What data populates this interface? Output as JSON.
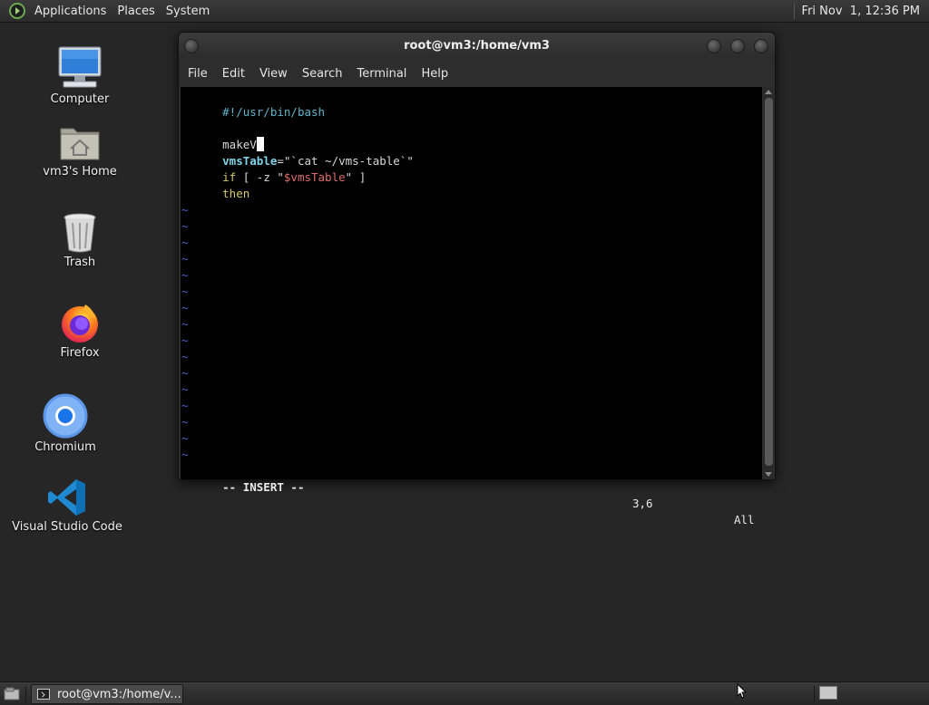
{
  "top_panel": {
    "menus": [
      "Applications",
      "Places",
      "System"
    ],
    "clock": "Fri Nov  1, 12:36 PM"
  },
  "desktop_icons": [
    {
      "label": "Computer",
      "icon": "computer-icon"
    },
    {
      "label": "vm3's Home",
      "icon": "home-folder-icon"
    },
    {
      "label": "Trash",
      "icon": "trash-icon"
    },
    {
      "label": "Firefox",
      "icon": "firefox-icon"
    },
    {
      "label": "Chromium",
      "icon": "chromium-icon"
    },
    {
      "label": "Visual Studio Code",
      "icon": "vscode-icon"
    }
  ],
  "terminal": {
    "title": "root@vm3:/home/vm3",
    "menu": [
      "File",
      "Edit",
      "View",
      "Search",
      "Terminal",
      "Help"
    ],
    "lines": {
      "shebang": "#!/usr/bin/bash",
      "make": "makeV",
      "assign_var": "vmsTable",
      "assign_eq": "=\"`cat ~/vms-table`\"",
      "if_kw": "if",
      "if_mid": " [ -z \"",
      "if_var": "$vmsTable",
      "if_end": "\" ]",
      "then_kw": "then"
    },
    "tilde": "~",
    "empty_line_count": 16,
    "status": {
      "mode": "-- INSERT --",
      "position": "3,6",
      "scroll": "All"
    }
  },
  "taskbar": {
    "task_label": "root@vm3:/home/v..."
  }
}
